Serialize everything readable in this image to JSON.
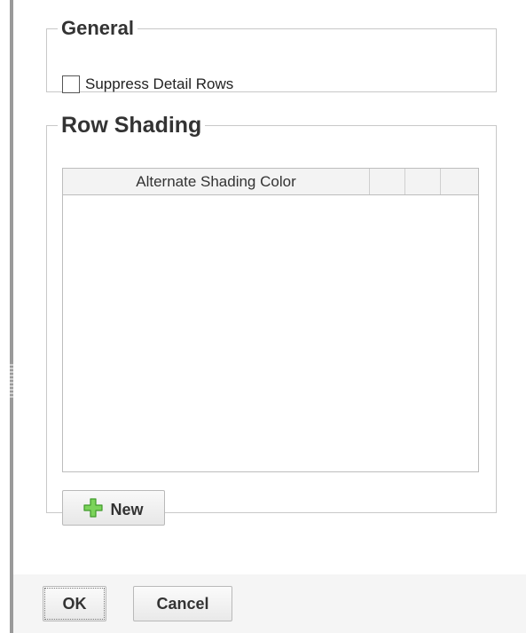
{
  "general": {
    "title": "General",
    "suppress_detail_rows": {
      "label": "Suppress Detail Rows",
      "checked": false
    }
  },
  "row_shading": {
    "title": "Row Shading",
    "grid": {
      "columns": [
        "Alternate Shading Color",
        "",
        "",
        ""
      ],
      "rows": []
    },
    "new_button_label": "New"
  },
  "footer": {
    "ok_label": "OK",
    "cancel_label": "Cancel"
  },
  "colors": {
    "plus_icon_fill": "#7bd35a",
    "plus_icon_stroke": "#3f9a2a",
    "border": "#c8c8c8",
    "footer_bg": "#f5f5f5"
  },
  "icons": {
    "new": "plus-icon"
  }
}
